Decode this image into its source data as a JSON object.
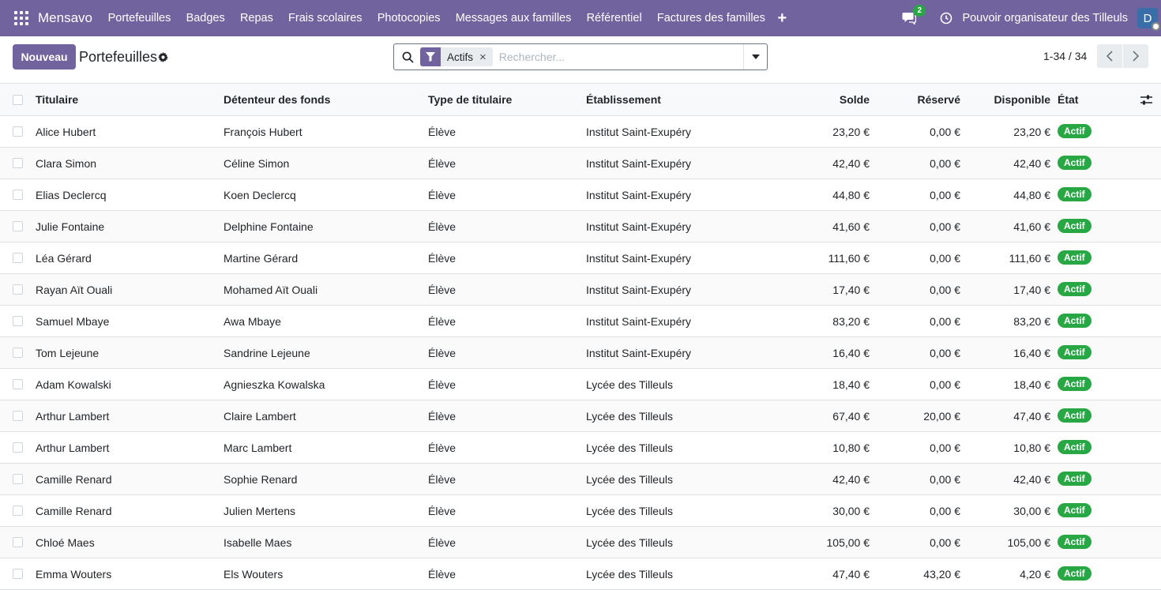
{
  "navbar": {
    "brand": "Mensavo",
    "menu": [
      "Portefeuilles",
      "Badges",
      "Repas",
      "Frais scolaires",
      "Photocopies",
      "Messages aux familles",
      "Référentiel",
      "Factures des familles"
    ],
    "plus": "+",
    "message_count": "2",
    "company": "Pouvoir organisateur des Tilleuls",
    "avatar_letter": "D"
  },
  "control": {
    "new_label": "Nouveau",
    "title": "Portefeuilles",
    "facet_label": "Actifs",
    "facet_remove": "×",
    "search_placeholder": "Rechercher...",
    "pager": "1-34 / 34"
  },
  "table": {
    "headers": {
      "titulaire": "Titulaire",
      "detenteur": "Détenteur des fonds",
      "type": "Type de titulaire",
      "etablissement": "Établissement",
      "solde": "Solde",
      "reserve": "Réservé",
      "disponible": "Disponible",
      "etat": "État"
    },
    "rows": [
      {
        "titulaire": "Alice Hubert",
        "detenteur": "François Hubert",
        "type": "Élève",
        "etablissement": "Institut Saint-Exupéry",
        "solde": "23,20 €",
        "reserve": "0,00 €",
        "disponible": "23,20 €",
        "etat": "Actif"
      },
      {
        "titulaire": "Clara Simon",
        "detenteur": "Céline Simon",
        "type": "Élève",
        "etablissement": "Institut Saint-Exupéry",
        "solde": "42,40 €",
        "reserve": "0,00 €",
        "disponible": "42,40 €",
        "etat": "Actif"
      },
      {
        "titulaire": "Elias Declercq",
        "detenteur": "Koen Declercq",
        "type": "Élève",
        "etablissement": "Institut Saint-Exupéry",
        "solde": "44,80 €",
        "reserve": "0,00 €",
        "disponible": "44,80 €",
        "etat": "Actif"
      },
      {
        "titulaire": "Julie Fontaine",
        "detenteur": "Delphine Fontaine",
        "type": "Élève",
        "etablissement": "Institut Saint-Exupéry",
        "solde": "41,60 €",
        "reserve": "0,00 €",
        "disponible": "41,60 €",
        "etat": "Actif"
      },
      {
        "titulaire": "Léa Gérard",
        "detenteur": "Martine Gérard",
        "type": "Élève",
        "etablissement": "Institut Saint-Exupéry",
        "solde": "111,60 €",
        "reserve": "0,00 €",
        "disponible": "111,60 €",
        "etat": "Actif"
      },
      {
        "titulaire": "Rayan Aït Ouali",
        "detenteur": "Mohamed Aït Ouali",
        "type": "Élève",
        "etablissement": "Institut Saint-Exupéry",
        "solde": "17,40 €",
        "reserve": "0,00 €",
        "disponible": "17,40 €",
        "etat": "Actif"
      },
      {
        "titulaire": "Samuel Mbaye",
        "detenteur": "Awa Mbaye",
        "type": "Élève",
        "etablissement": "Institut Saint-Exupéry",
        "solde": "83,20 €",
        "reserve": "0,00 €",
        "disponible": "83,20 €",
        "etat": "Actif"
      },
      {
        "titulaire": "Tom Lejeune",
        "detenteur": "Sandrine Lejeune",
        "type": "Élève",
        "etablissement": "Institut Saint-Exupéry",
        "solde": "16,40 €",
        "reserve": "0,00 €",
        "disponible": "16,40 €",
        "etat": "Actif"
      },
      {
        "titulaire": "Adam Kowalski",
        "detenteur": "Agnieszka Kowalska",
        "type": "Élève",
        "etablissement": "Lycée des Tilleuls",
        "solde": "18,40 €",
        "reserve": "0,00 €",
        "disponible": "18,40 €",
        "etat": "Actif"
      },
      {
        "titulaire": "Arthur Lambert",
        "detenteur": "Claire Lambert",
        "type": "Élève",
        "etablissement": "Lycée des Tilleuls",
        "solde": "67,40 €",
        "reserve": "20,00 €",
        "disponible": "47,40 €",
        "etat": "Actif"
      },
      {
        "titulaire": "Arthur Lambert",
        "detenteur": "Marc Lambert",
        "type": "Élève",
        "etablissement": "Lycée des Tilleuls",
        "solde": "10,80 €",
        "reserve": "0,00 €",
        "disponible": "10,80 €",
        "etat": "Actif"
      },
      {
        "titulaire": "Camille Renard",
        "detenteur": "Sophie Renard",
        "type": "Élève",
        "etablissement": "Lycée des Tilleuls",
        "solde": "42,40 €",
        "reserve": "0,00 €",
        "disponible": "42,40 €",
        "etat": "Actif"
      },
      {
        "titulaire": "Camille Renard",
        "detenteur": "Julien Mertens",
        "type": "Élève",
        "etablissement": "Lycée des Tilleuls",
        "solde": "30,00 €",
        "reserve": "0,00 €",
        "disponible": "30,00 €",
        "etat": "Actif"
      },
      {
        "titulaire": "Chloé Maes",
        "detenteur": "Isabelle Maes",
        "type": "Élève",
        "etablissement": "Lycée des Tilleuls",
        "solde": "105,00 €",
        "reserve": "0,00 €",
        "disponible": "105,00 €",
        "etat": "Actif"
      },
      {
        "titulaire": "Emma Wouters",
        "detenteur": "Els Wouters",
        "type": "Élève",
        "etablissement": "Lycée des Tilleuls",
        "solde": "47,40 €",
        "reserve": "43,20 €",
        "disponible": "4,20 €",
        "etat": "Actif"
      }
    ]
  },
  "colors": {
    "brand": "#71639e",
    "active_badge": "#28a745"
  }
}
